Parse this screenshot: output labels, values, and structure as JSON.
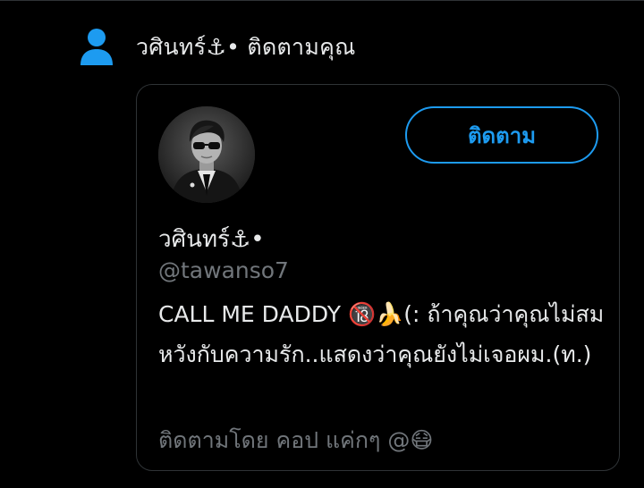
{
  "notification": {
    "icon": "person-icon",
    "text": "วศินทร์⚓• ติดตามคุณ"
  },
  "profile_card": {
    "avatar": "avatar",
    "follow_button_label": "ติดตาม",
    "display_name": "วศินทร์⚓•",
    "handle": "@tawanso7",
    "bio": "CALL ME DADDY 🔞🍌(: ถ้าคุณว่าคุณไม่สมหวังกับความรัก..แสดงว่าคุณยังไม่เจอผม.(ท.)",
    "followed_by": "ติดตามโดย คอป แค่กๆ @😷"
  },
  "colors": {
    "background": "#000000",
    "accent": "#1d9bf0",
    "text_primary": "#e7e9ea",
    "text_secondary": "#71767b",
    "border": "#2f3336"
  }
}
